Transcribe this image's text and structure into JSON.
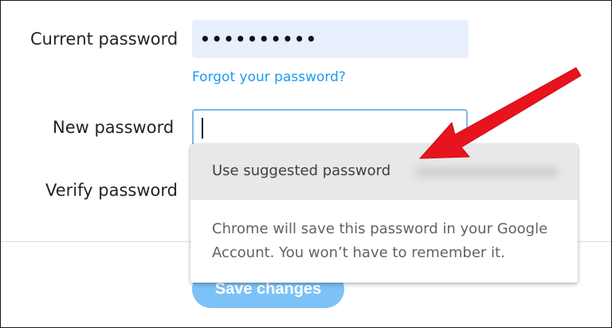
{
  "form": {
    "current_password_label": "Current password",
    "current_password_value": "••••••••••",
    "forgot_link": "Forgot your password?",
    "new_password_label": "New password",
    "new_password_value": "",
    "verify_password_label": "Verify password",
    "save_button": "Save changes"
  },
  "autofill_popup": {
    "option_label": "Use suggested password",
    "note": "Chrome will save this password in your Google Account. You won’t have to remember it."
  },
  "colors": {
    "link": "#1d9bf0",
    "button": "#7cc2f7",
    "arrow": "#e8141d",
    "autofill_bg": "#e8f0fe"
  }
}
